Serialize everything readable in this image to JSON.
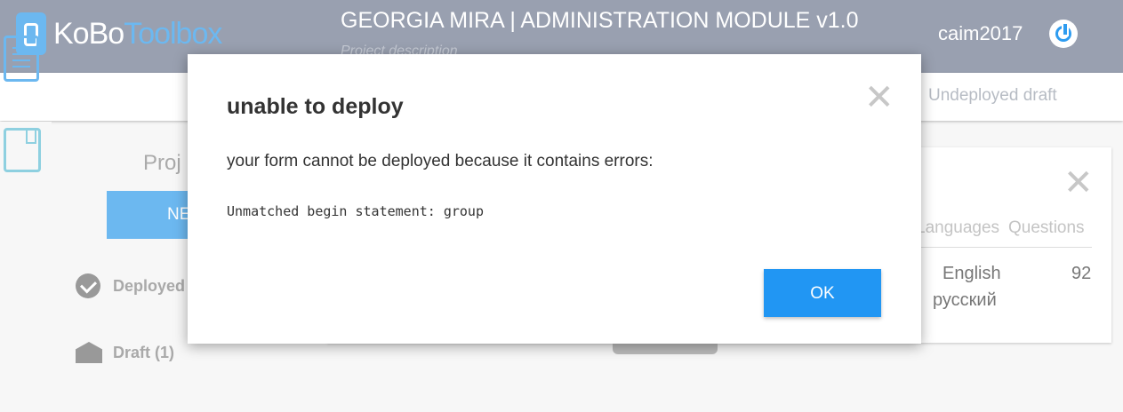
{
  "app": {
    "logo_text_part1": "KoBo",
    "logo_text_part2": "Toolbox",
    "project_title": "GEORGIA MIRA | ADMINISTRATION MODULE v1.0",
    "project_description_placeholder": "Project description",
    "username": "caim2017"
  },
  "subbar": {
    "status": "Undeployed draft"
  },
  "sidebar": {
    "title_partial": "Proj",
    "new_button_partial": "NE",
    "items": [
      {
        "label_partial": "Deployed"
      },
      {
        "label": "Draft (1)"
      }
    ]
  },
  "card": {
    "columns": [
      "Languages",
      "Questions"
    ],
    "languages": [
      "English",
      "русский"
    ],
    "questions": "92"
  },
  "modal": {
    "title": "unable to deploy",
    "message": "your form cannot be deployed because it contains errors:",
    "error": "Unmatched begin statement: group",
    "ok_label": "OK",
    "close_glyph": "✕"
  },
  "colors": {
    "topbar": "#99a0b0",
    "accent": "#2196f3",
    "logo_blue": "#6cb8f0"
  }
}
